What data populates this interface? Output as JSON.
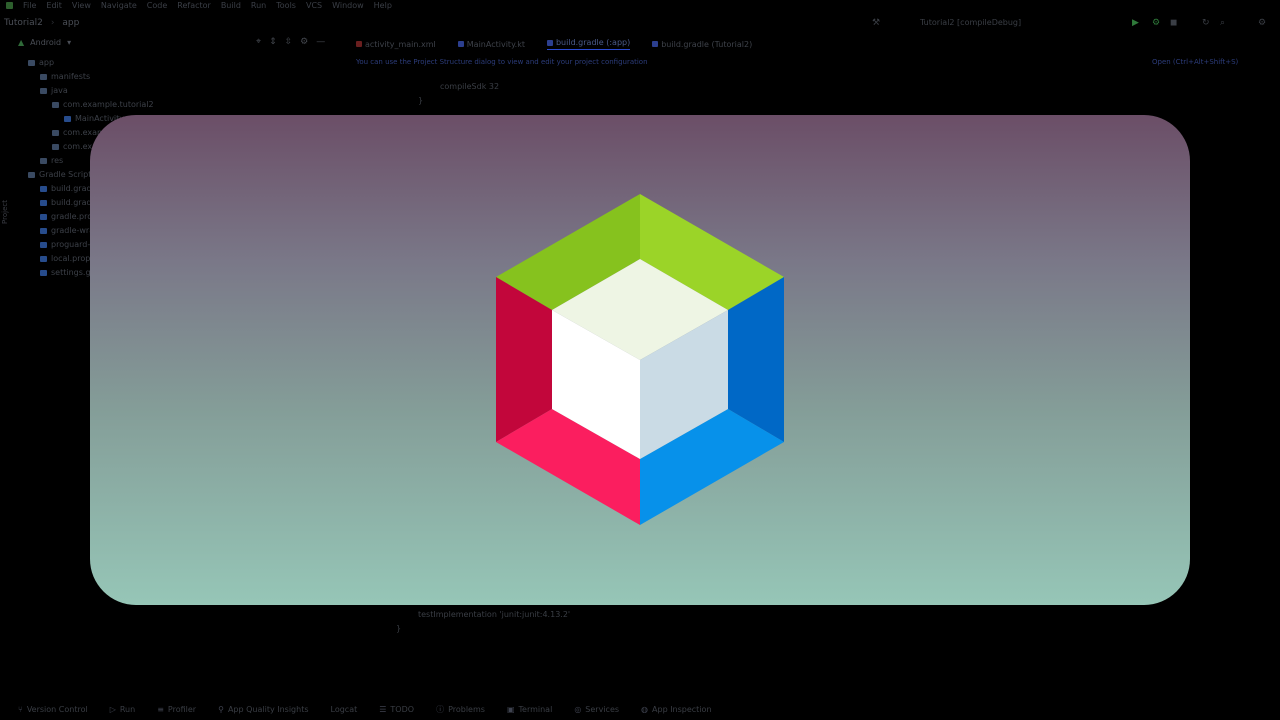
{
  "menu": {
    "items": [
      "File",
      "Edit",
      "View",
      "Navigate",
      "Code",
      "Refactor",
      "Build",
      "Run",
      "Tools",
      "VCS",
      "Window",
      "Help"
    ]
  },
  "breadcrumbs": [
    "Tutorial2",
    "app"
  ],
  "run_config": "Tutorial2 [compileDebug]",
  "project_view": {
    "selector": "Android",
    "tree": [
      {
        "label": "app",
        "indent": 0,
        "icon": "folder"
      },
      {
        "label": "manifests",
        "indent": 1,
        "icon": "folder"
      },
      {
        "label": "java",
        "indent": 1,
        "icon": "folder"
      },
      {
        "label": "com.example.tutorial2",
        "indent": 2,
        "icon": "folder"
      },
      {
        "label": "MainActivity",
        "indent": 3,
        "icon": "file"
      },
      {
        "label": "com.example.tutorial2",
        "indent": 2,
        "icon": "folder"
      },
      {
        "label": "com.example.tutorial2",
        "indent": 2,
        "icon": "folder"
      },
      {
        "label": "res",
        "indent": 1,
        "icon": "folder"
      },
      {
        "label": "Gradle Scripts",
        "indent": 0,
        "icon": "folder"
      },
      {
        "label": "build.gradle",
        "indent": 1,
        "icon": "file"
      },
      {
        "label": "build.gradle",
        "indent": 1,
        "icon": "file"
      },
      {
        "label": "gradle.properties",
        "indent": 1,
        "icon": "file"
      },
      {
        "label": "gradle-wrapper.properties",
        "indent": 1,
        "icon": "file"
      },
      {
        "label": "proguard-rules.pro",
        "indent": 1,
        "icon": "file"
      },
      {
        "label": "local.properties",
        "indent": 1,
        "icon": "file"
      },
      {
        "label": "settings.gradle",
        "indent": 1,
        "icon": "file"
      }
    ]
  },
  "side_label": "Project",
  "editor_tabs": [
    {
      "label": "activity_main.xml",
      "active": false,
      "kind": "xml"
    },
    {
      "label": "MainActivity.kt",
      "active": false,
      "kind": "kt"
    },
    {
      "label": "build.gradle (:app)",
      "active": true,
      "kind": "gradle"
    },
    {
      "label": "build.gradle (Tutorial2)",
      "active": false,
      "kind": "gradle"
    }
  ],
  "notice": {
    "text": "You can use the Project Structure dialog to view and edit your project configuration",
    "link": "Open (Ctrl+Alt+Shift+S)"
  },
  "code": {
    "line1": "}",
    "line2": "compileSdk 32",
    "line3": "testImplementation 'junit:junit:4.13.2'",
    "line4": "}"
  },
  "bottom_tools": [
    "Version Control",
    "Run",
    "Profiler",
    "App Quality Insights",
    "Logcat",
    "TODO",
    "Problems",
    "Terminal",
    "Services",
    "App Inspection"
  ],
  "splash": {
    "colors": {
      "top": "#6b4e67",
      "bottom": "#96c6b7",
      "green_light": "#9bd428",
      "green_dark": "#86c21e",
      "red_dark": "#c2063b",
      "red_light": "#fb1e5f",
      "blue_dark": "#0068c6",
      "blue_light": "#0791ea",
      "cube_top": "#eef5e4",
      "cube_left": "#ffffff",
      "cube_right": "#cadbe5"
    }
  }
}
